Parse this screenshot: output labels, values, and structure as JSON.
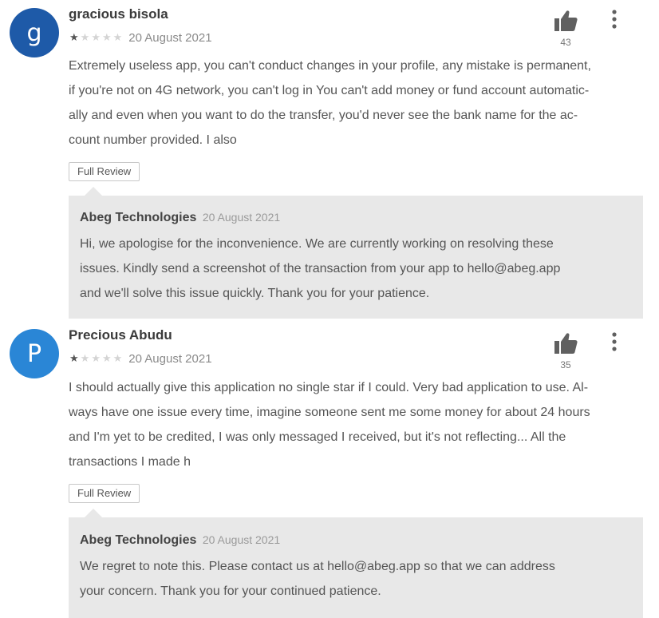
{
  "reviews": [
    {
      "avatar_letter": "g",
      "avatar_color": "#1e5aa8",
      "author": "gracious bisola",
      "rating": 1,
      "rating_max": 5,
      "date": "20 August 2021",
      "likes": "43",
      "lines": [
        "Extremely useless app, you can't conduct changes in your profile, any mistake is permanent,",
        "if you're not on 4G network, you can't log in You can't add money or fund account automatic-",
        "ally and even when you want to do the transfer, you'd never see the bank name for the ac-",
        "count number provided. I also"
      ],
      "full_review_label": "Full Review",
      "reply": {
        "author": "Abeg Technologies",
        "date": "20 August 2021",
        "lines": [
          "Hi, we apologise for the inconvenience. We are currently working on resolving these",
          "issues. Kindly send a screenshot of the transaction from your app to hello@abeg.app",
          "and we'll solve this issue quickly. Thank you for your patience."
        ]
      }
    },
    {
      "avatar_letter": "P",
      "avatar_color": "#2a86d6",
      "author": "Precious Abudu",
      "rating": 1,
      "rating_max": 5,
      "date": "20 August 2021",
      "likes": "35",
      "lines": [
        "I should actually give this application no single star if I could. Very bad application to use. Al-",
        "ways have one issue every time, imagine someone sent me some money for about 24 hours",
        "and I'm yet to be credited, I was only messaged I received, but it's not reflecting... All the",
        "transactions I made h"
      ],
      "full_review_label": "Full Review",
      "reply": {
        "author": "Abeg Technologies",
        "date": "20 August 2021",
        "lines": [
          "We regret to note this. Please contact us at hello@abeg.app so that we can address",
          "your concern. Thank you for your continued patience."
        ]
      }
    }
  ]
}
